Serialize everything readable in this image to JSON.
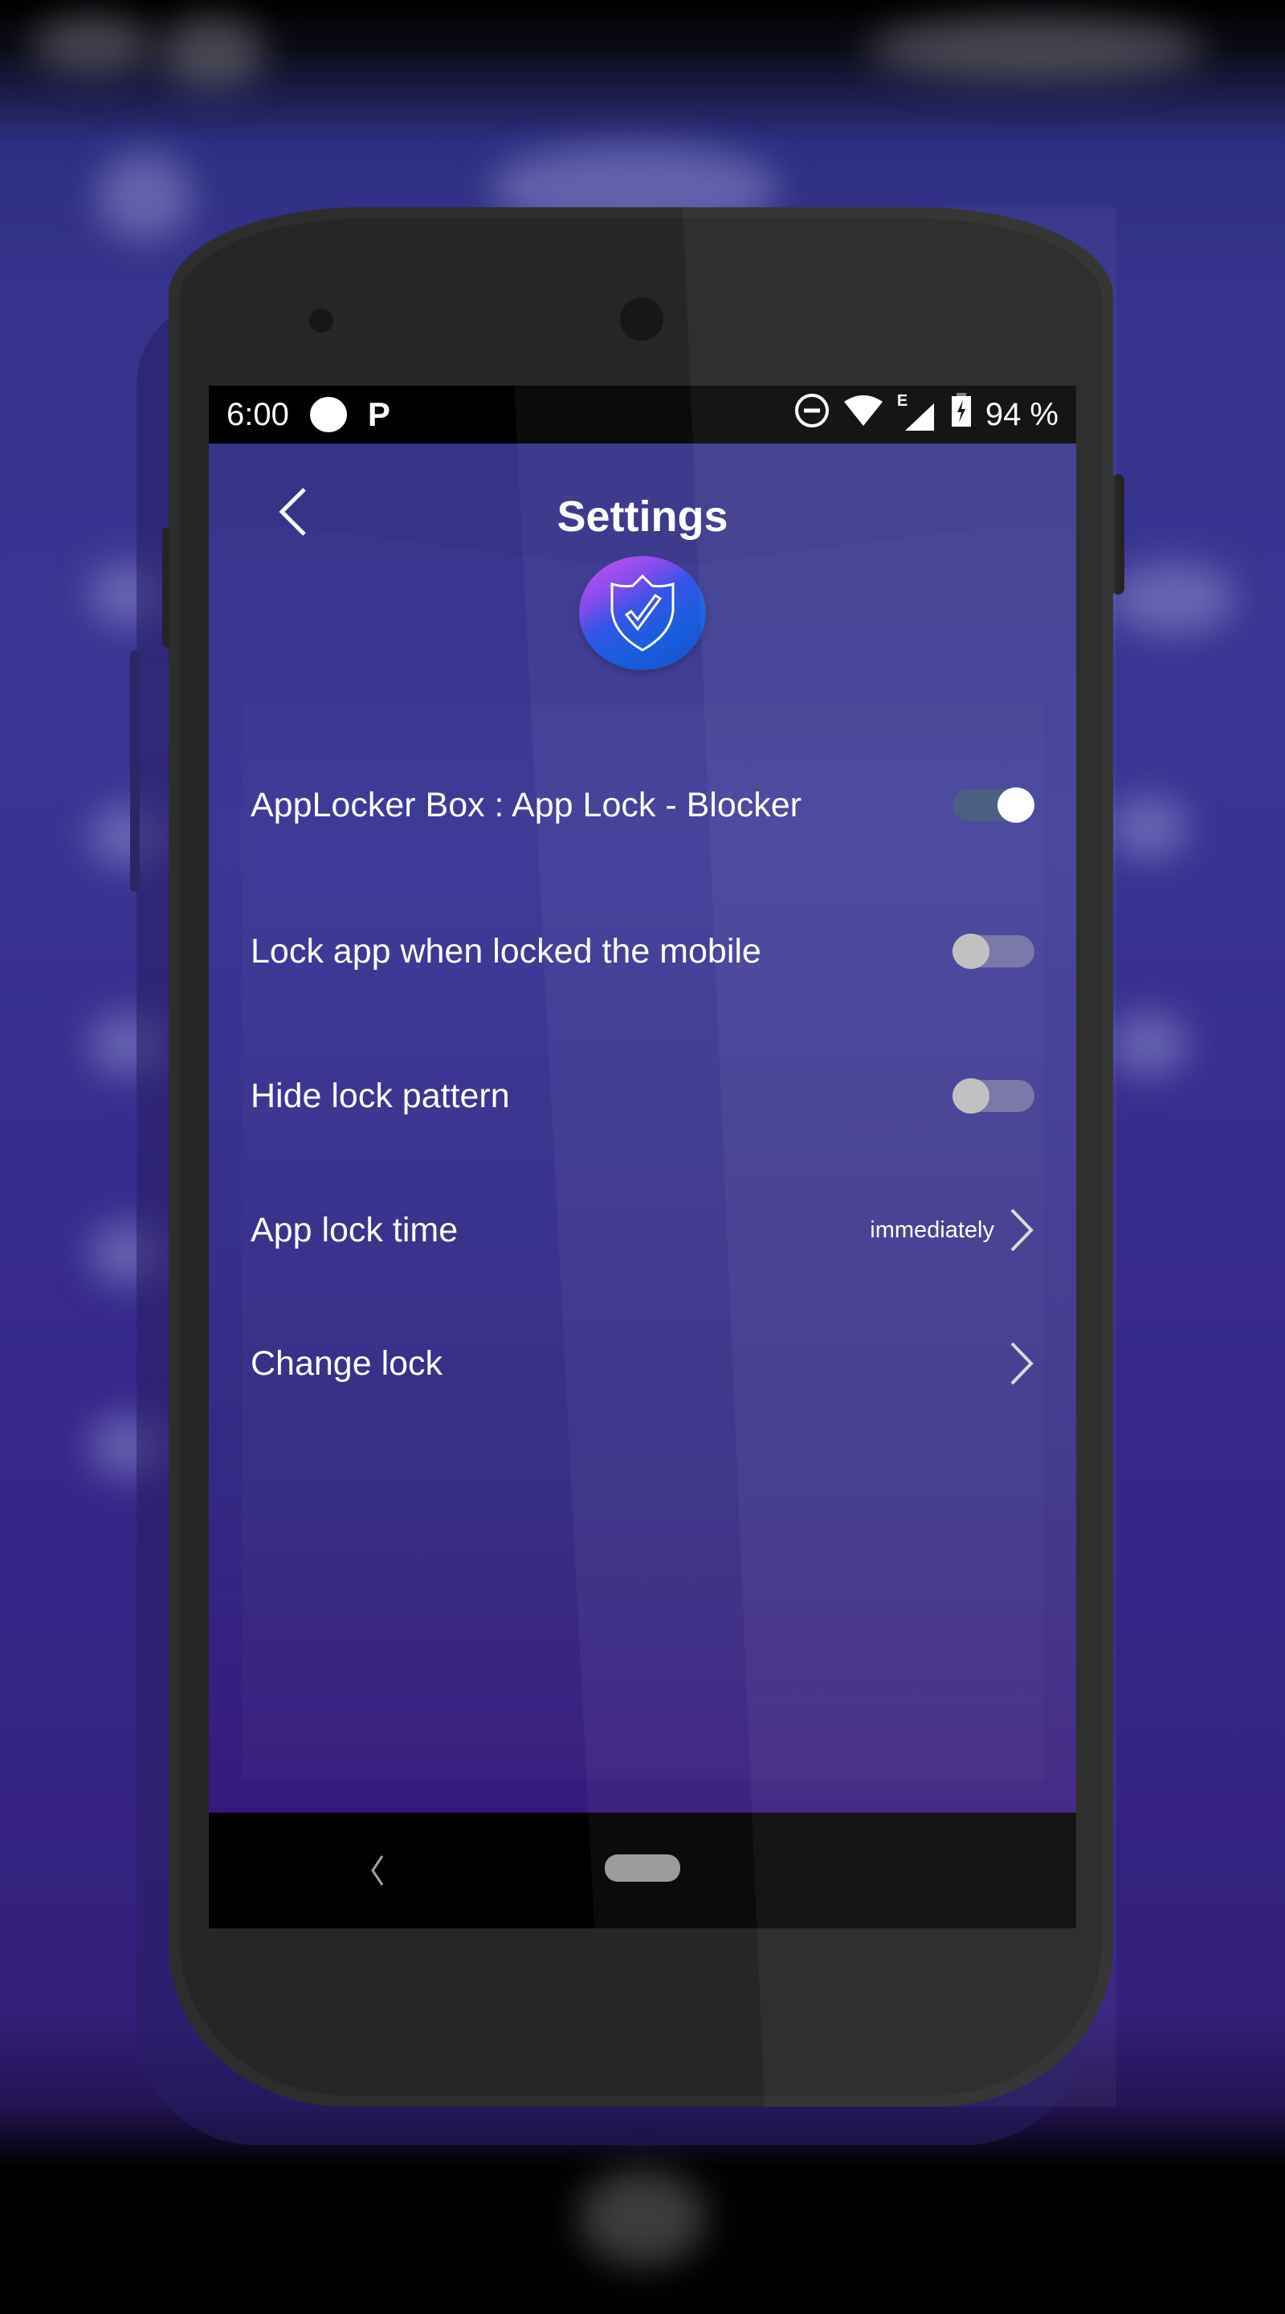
{
  "status_bar": {
    "time": "6:00",
    "left_icons": [
      "notification-dot-icon",
      "parking-p-icon"
    ],
    "p_glyph": "P",
    "right_icons": [
      "do-not-disturb-icon",
      "wifi-icon",
      "mobile-signal-icon",
      "battery-charging-icon"
    ],
    "network_type": "E",
    "battery_percent": "94 %"
  },
  "header": {
    "title": "Settings",
    "back_icon": "chevron-left-icon",
    "badge_icon": "shield-check-icon"
  },
  "settings": [
    {
      "label": "AppLocker Box : App Lock - Blocker",
      "type": "toggle",
      "enabled": true
    },
    {
      "label": "Lock app when locked the mobile",
      "type": "toggle",
      "enabled": false
    },
    {
      "label": "Hide lock pattern",
      "type": "toggle",
      "enabled": false
    },
    {
      "label": "App lock time",
      "type": "link",
      "value": "immediately"
    },
    {
      "label": "Change lock",
      "type": "link",
      "value": ""
    }
  ],
  "nav_bar": {
    "back_icon": "nav-back-icon",
    "home_icon": "nav-home-pill-icon"
  },
  "colors": {
    "toggle_on_track": "#3b5178",
    "toggle_on_knob": "#ffffff",
    "toggle_off_track": "#6f6da3",
    "toggle_off_knob": "#bdbdbd",
    "badge_gradient_start": "#d04cf0",
    "badge_gradient_end": "#0e56dc",
    "app_background": "#38348f"
  }
}
